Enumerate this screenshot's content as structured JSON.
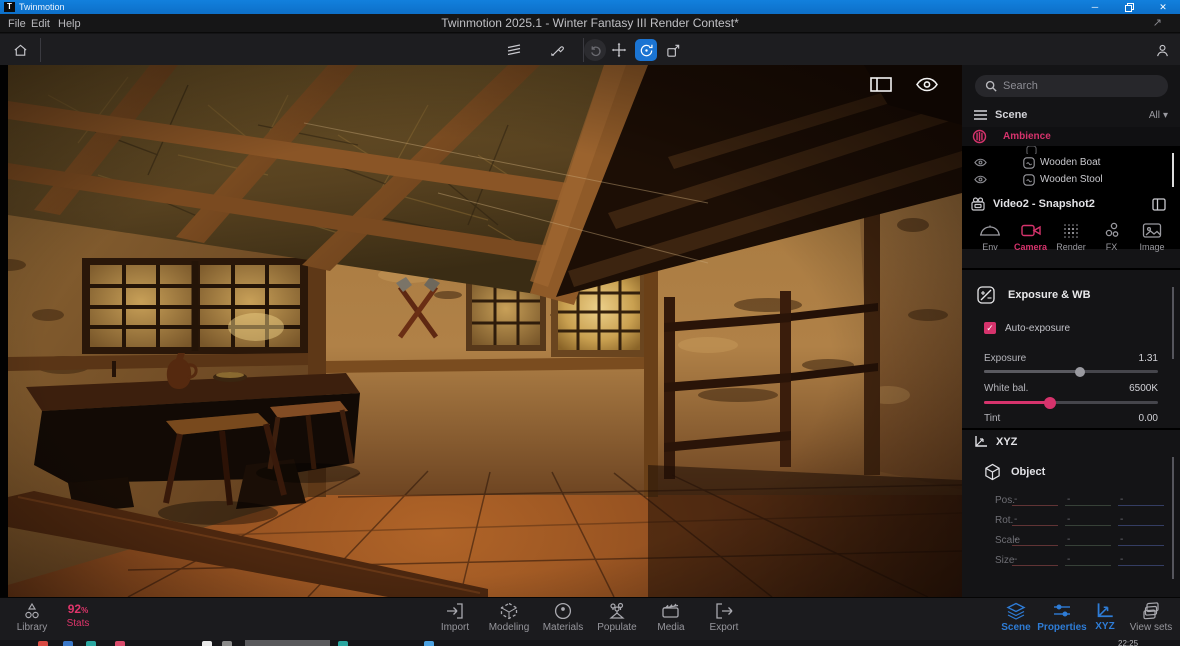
{
  "window": {
    "app_name": "Twinmotion",
    "logo_letter": "T",
    "controls": {
      "minimize": "─",
      "close": "✕"
    }
  },
  "menu": {
    "items": [
      {
        "label": "File"
      },
      {
        "label": "Edit"
      },
      {
        "label": "Help"
      }
    ],
    "document_title": "Twinmotion 2025.1 - Winter Fantasy III Render Contest*",
    "expand_glyph": "↗"
  },
  "toolbar": {
    "icons": [
      "home-icon",
      "layers-icon",
      "eyedropper-icon",
      "undo-icon",
      "move-icon",
      "rotate-icon",
      "scale-icon",
      "account-icon"
    ],
    "active_tool": "rotate"
  },
  "viewport": {
    "overlay_icons": [
      "split-view-icon",
      "eye-icon"
    ]
  },
  "right_panel": {
    "search": {
      "placeholder": "Search"
    },
    "scene_tree": {
      "title": "Scene",
      "filter": "All",
      "caret": "▾",
      "items": [
        {
          "label": "Ambience",
          "selected": true,
          "icon": "ambience-icon"
        },
        {
          "label": "Wooden Boat",
          "icon": "object-icon"
        },
        {
          "label": "Wooden Stool",
          "icon": "object-icon"
        }
      ]
    },
    "properties": {
      "title": "Video2 - Snapshot2",
      "tabs": [
        {
          "label": "Env",
          "icon": "env-dome-icon",
          "active": false
        },
        {
          "label": "Camera",
          "icon": "video-camera-icon",
          "active": true
        },
        {
          "label": "Render",
          "icon": "render-dots-icon",
          "active": false
        },
        {
          "label": "FX",
          "icon": "fx-circles-icon",
          "active": false
        },
        {
          "label": "Image",
          "icon": "image-icon",
          "active": false
        }
      ],
      "exposure_section": {
        "title": "Exposure & WB",
        "auto_exposure_label": "Auto-exposure",
        "auto_exposure_checked": true,
        "check_glyph": "✓",
        "sliders": [
          {
            "label": "Exposure",
            "value": "1.31",
            "percent": 55,
            "accent": false
          },
          {
            "label": "White bal.",
            "value": "6500K",
            "percent": 38,
            "accent": true
          },
          {
            "label": "Tint",
            "value": "0.00",
            "percent": null
          }
        ]
      }
    },
    "xyz_panel": {
      "title": "XYZ",
      "object_label": "Object",
      "placeholder": "-",
      "rows": [
        {
          "label": "Pos."
        },
        {
          "label": "Rot."
        },
        {
          "label": "Scale"
        },
        {
          "label": "Size"
        }
      ]
    }
  },
  "bottom_bar": {
    "library_label": "Library",
    "stats": {
      "value": "92",
      "unit": "%",
      "label": "Stats"
    },
    "center": [
      {
        "label": "Import",
        "icon": "import-icon"
      },
      {
        "label": "Modeling",
        "icon": "modeling-icon"
      },
      {
        "label": "Materials",
        "icon": "materials-icon"
      },
      {
        "label": "Populate",
        "icon": "populate-icon"
      },
      {
        "label": "Media",
        "icon": "media-icon"
      },
      {
        "label": "Export",
        "icon": "export-icon"
      }
    ],
    "right": [
      {
        "label": "Scene",
        "icon": "scene-layers-icon",
        "active": true
      },
      {
        "label": "Properties",
        "icon": "properties-sliders-icon",
        "active": true
      },
      {
        "label": "XYZ",
        "icon": "xyz-axis-icon",
        "active": true
      },
      {
        "label": "View sets",
        "icon": "view-sets-icon",
        "active": false
      }
    ]
  },
  "taskbar": {
    "clock": "22:25"
  },
  "colors": {
    "accent_pink": "#d6336c",
    "accent_blue": "#2e7cd6",
    "titlebar_blue": "#0f7bd7"
  }
}
